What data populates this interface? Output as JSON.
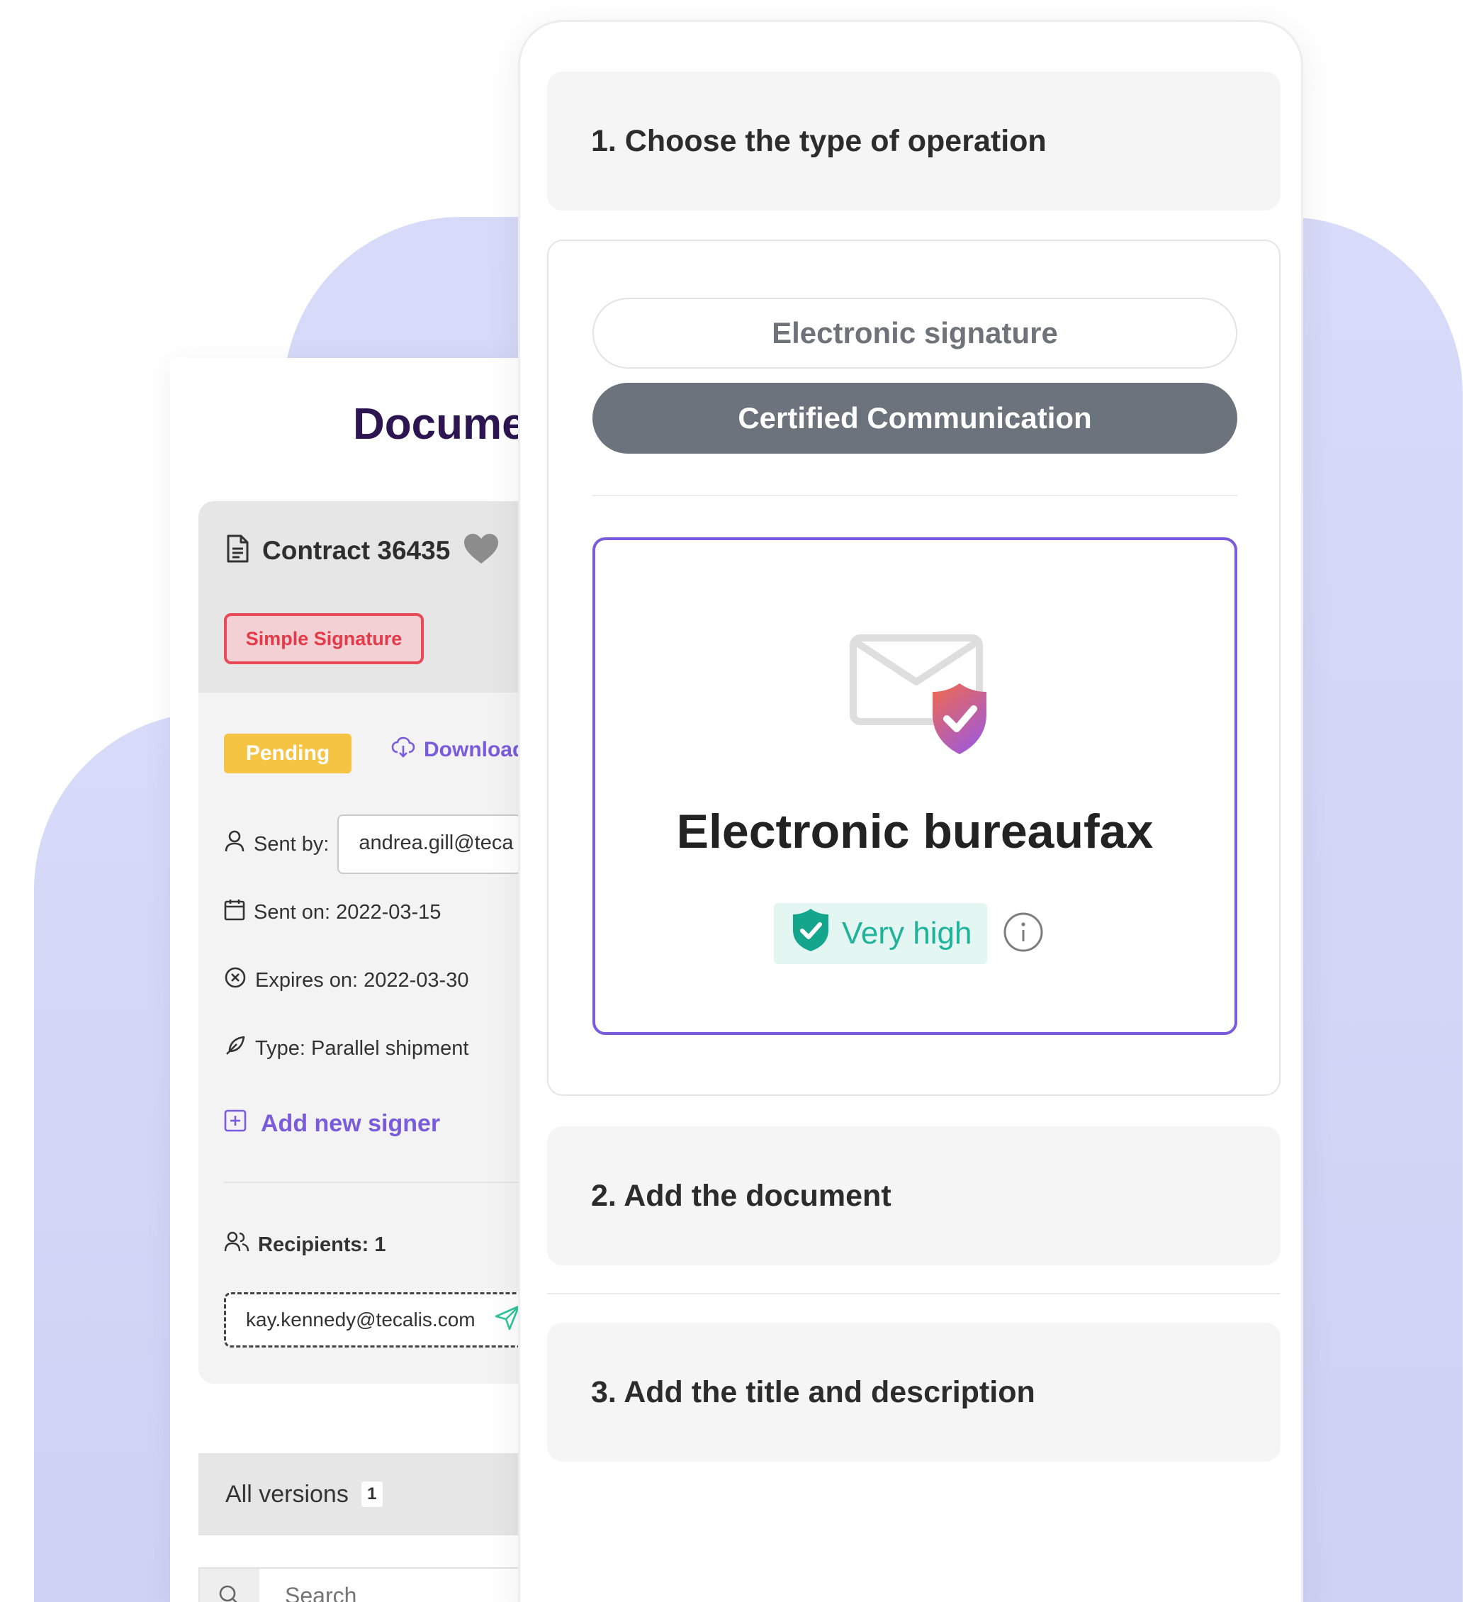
{
  "document_panel": {
    "title": "Docume",
    "contract": {
      "title": "Contract 36435",
      "signature_type": "Simple Signature"
    },
    "status": "Pending",
    "download_label": "Download",
    "sent_by_label": "Sent by:",
    "sent_by_value": "andrea.gill@teca",
    "sent_on": "Sent on: 2022-03-15",
    "expires_on": "Expires on: 2022-03-30",
    "type": "Type: Parallel shipment",
    "add_signer_label": "Add new signer",
    "recipients_label": "Recipients: 1",
    "recipient_email": "kay.kennedy@tecalis.com",
    "versions_label": "All versions",
    "versions_count": "1",
    "search_placeholder": "Search"
  },
  "wizard": {
    "step1": "1. Choose the type of operation",
    "operation_types": [
      "Electronic signature",
      "Certified Communication"
    ],
    "selected_operation": "Certified Communication",
    "option": {
      "title": "Electronic bureaufax",
      "security_level": "Very high"
    },
    "step2": "2. Add the document",
    "step3": "3. Add the title and description"
  },
  "colors": {
    "accent": "#7a5bdc",
    "pending": "#f6c443",
    "simple_signature": "#e84a57",
    "security_level": "#1fb39b",
    "selected_pill": "#6c737c",
    "background_blob": "#d6d8f8"
  }
}
